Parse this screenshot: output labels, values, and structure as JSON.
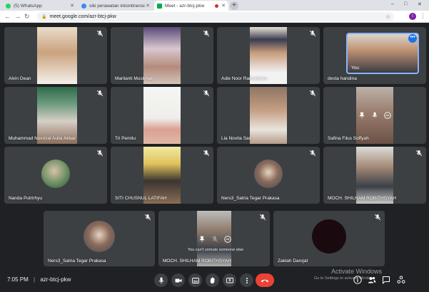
{
  "browser": {
    "tabs": [
      {
        "title": "(5) WhatsApp",
        "favicon_color": "#25d366"
      },
      {
        "title": "siki perawatan inkontinensia fekal",
        "favicon_color": "#4285f4"
      },
      {
        "title": "Meet - azr-btcj-pkw",
        "favicon_color": "#00ac47"
      }
    ],
    "url": "meet.google.com/azr-btcj-pkw",
    "profile_initial": "I",
    "window_controls": [
      "–",
      "□",
      "✕"
    ]
  },
  "participants": [
    {
      "name": "Alvin Dean",
      "muted": true
    },
    {
      "name": "Marlianti Muslimah",
      "muted": true
    },
    {
      "name": "Adie Noor Ramadhani",
      "muted": true
    },
    {
      "name": "desta handina",
      "muted": false
    },
    {
      "name": "Muhammad Novrizal Aulia Akbar",
      "muted": true
    },
    {
      "name": "Tri Pemilu",
      "muted": true
    },
    {
      "name": "Lia Novita Sari",
      "muted": true
    },
    {
      "name": "Safina Filus Soffyah",
      "muted": false
    },
    {
      "name": "Nanda Putrirhyu",
      "muted": true
    },
    {
      "name": "SITI CHUSNUL LATIFAH",
      "muted": true
    },
    {
      "name": "Ners3_Satria Tegar Prakasa",
      "muted": true
    },
    {
      "name": "MOCH. SHILHAM ROBITHSYAH",
      "muted": true
    },
    {
      "name": "Ners3_Satria Tegar Prakasa",
      "muted": true
    },
    {
      "name": "MOCH. SHILHAM ROBITHSYAH",
      "muted": true
    },
    {
      "name": "Zakiah Darojat",
      "muted": true
    }
  ],
  "self": {
    "label": "You",
    "more_options": "•••"
  },
  "cant_unmute_hint": "You can't unmute someone else",
  "meeting": {
    "time": "7:05 PM",
    "separator": "|",
    "code": "azr-btcj-pkw"
  },
  "controls": [
    "mic",
    "camera",
    "captions",
    "raise-hand",
    "present",
    "more",
    "end-call"
  ],
  "right_controls": [
    "info",
    "people",
    "chat",
    "activities"
  ],
  "watermark": {
    "line1": "Activate Windows",
    "line2": "Go to Settings to activate Windows."
  }
}
